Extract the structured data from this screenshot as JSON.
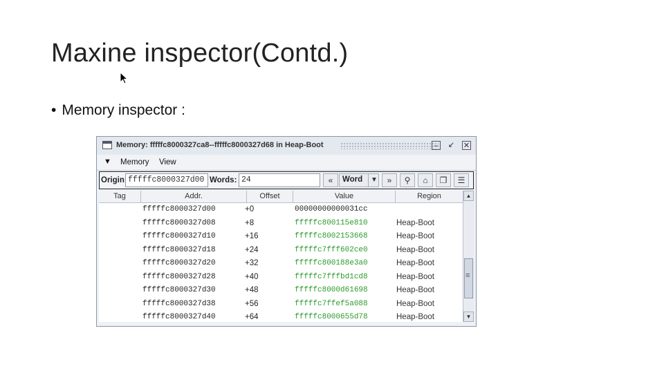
{
  "slide": {
    "title": "Maxine inspector(Contd.)",
    "bullet": "Memory inspector :"
  },
  "window": {
    "title": "Memory: fffffc8000327ca8--fffffc8000327d68 in Heap-Boot"
  },
  "menu": {
    "items": [
      "Memory",
      "View"
    ]
  },
  "toolbar": {
    "origin_label": "Origin:",
    "origin_value": "fffffc8000327d00",
    "words_label": "Words:",
    "words_value": "24",
    "word_button": "Word",
    "icons": [
      "prev-icon",
      "word-dropdown-icon",
      "next-icon",
      "find-icon",
      "home-icon",
      "copy-icon",
      "options-icon"
    ]
  },
  "table": {
    "columns": [
      "Tag",
      "Addr.",
      "Offset",
      "Value",
      "Region"
    ],
    "rows": [
      {
        "tag": "",
        "addr": "fffffc8000327d00",
        "offset": "+0",
        "value": "00000000000031cc",
        "value_green": false,
        "region": ""
      },
      {
        "tag": "",
        "addr": "fffffc8000327d08",
        "offset": "+8",
        "value": "fffffc800115e810",
        "value_green": true,
        "region": "Heap-Boot"
      },
      {
        "tag": "",
        "addr": "fffffc8000327d10",
        "offset": "+16",
        "value": "fffffc8002153668",
        "value_green": true,
        "region": "Heap-Boot"
      },
      {
        "tag": "",
        "addr": "fffffc8000327d18",
        "offset": "+24",
        "value": "fffffc7fff602ce0",
        "value_green": true,
        "region": "Heap-Boot"
      },
      {
        "tag": "",
        "addr": "fffffc8000327d20",
        "offset": "+32",
        "value": "fffffc800188e3a0",
        "value_green": true,
        "region": "Heap-Boot"
      },
      {
        "tag": "",
        "addr": "fffffc8000327d28",
        "offset": "+40",
        "value": "fffffc7fffbd1cd8",
        "value_green": true,
        "region": "Heap-Boot"
      },
      {
        "tag": "",
        "addr": "fffffc8000327d30",
        "offset": "+48",
        "value": "fffffc8000d61698",
        "value_green": true,
        "region": "Heap-Boot"
      },
      {
        "tag": "",
        "addr": "fffffc8000327d38",
        "offset": "+56",
        "value": "fffffc7ffef5a088",
        "value_green": true,
        "region": "Heap-Boot"
      },
      {
        "tag": "",
        "addr": "fffffc8000327d40",
        "offset": "+64",
        "value": "fffffc8000655d78",
        "value_green": true,
        "region": "Heap-Boot"
      }
    ]
  },
  "colors": {
    "value_green": "#2a9a2a",
    "window_bg": "#eef1f6"
  }
}
